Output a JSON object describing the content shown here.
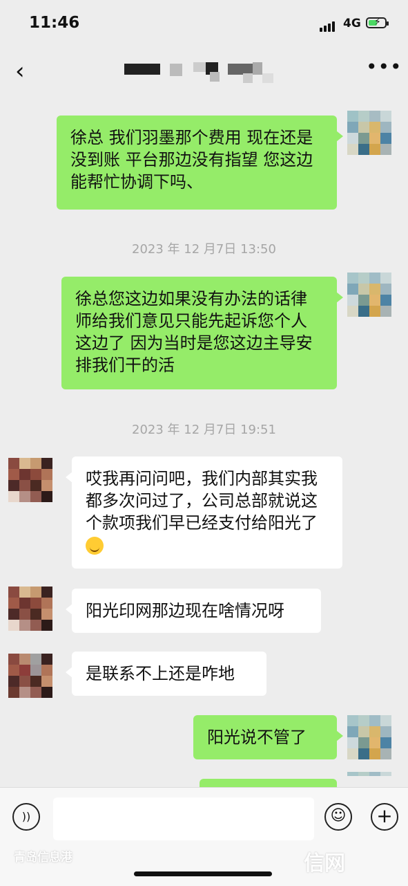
{
  "status_bar": {
    "time": "11:46",
    "network": "4G",
    "battery_icon": "battery-charging-icon"
  },
  "nav": {
    "back_icon": "chevron-left-icon",
    "more_icon": "more-dots-icon",
    "more_label": "•••"
  },
  "messages": [
    {
      "side": "out",
      "text": "徐总 我们羽墨那个费用 现在还是没到账 平台那边没有指望 您这边能帮忙协调下吗、"
    },
    {
      "type": "timestamp",
      "text": "2023 年 12 月7日 13:50"
    },
    {
      "side": "out",
      "text": "徐总您这边如果没有办法的话律师给我们意见只能先起诉您个人这边了 因为当时是您这边主导安排我们干的活"
    },
    {
      "type": "timestamp",
      "text": "2023 年 12 月7日 19:51"
    },
    {
      "side": "in",
      "text": "哎我再问问吧，我们内部其实我都多次问过了，公司总部就说这个款项我们早已经支付给阳光了",
      "emoji": "grimace-emoji-icon"
    },
    {
      "side": "in",
      "text": "阳光印网那边现在啥情况呀"
    },
    {
      "side": "in",
      "text": "是联系不上还是咋地"
    },
    {
      "side": "out",
      "text": "阳光说不管了"
    }
  ],
  "input_bar": {
    "voice_icon": "voice-icon",
    "emoji_icon": "emoji-icon",
    "plus_icon": "plus-icon",
    "input_value": ""
  },
  "watermarks": {
    "left": "青岛信息港",
    "right": "信网"
  },
  "colors": {
    "outgoing_bubble": "#95ec69",
    "incoming_bubble": "#ffffff",
    "background": "#ededed"
  }
}
